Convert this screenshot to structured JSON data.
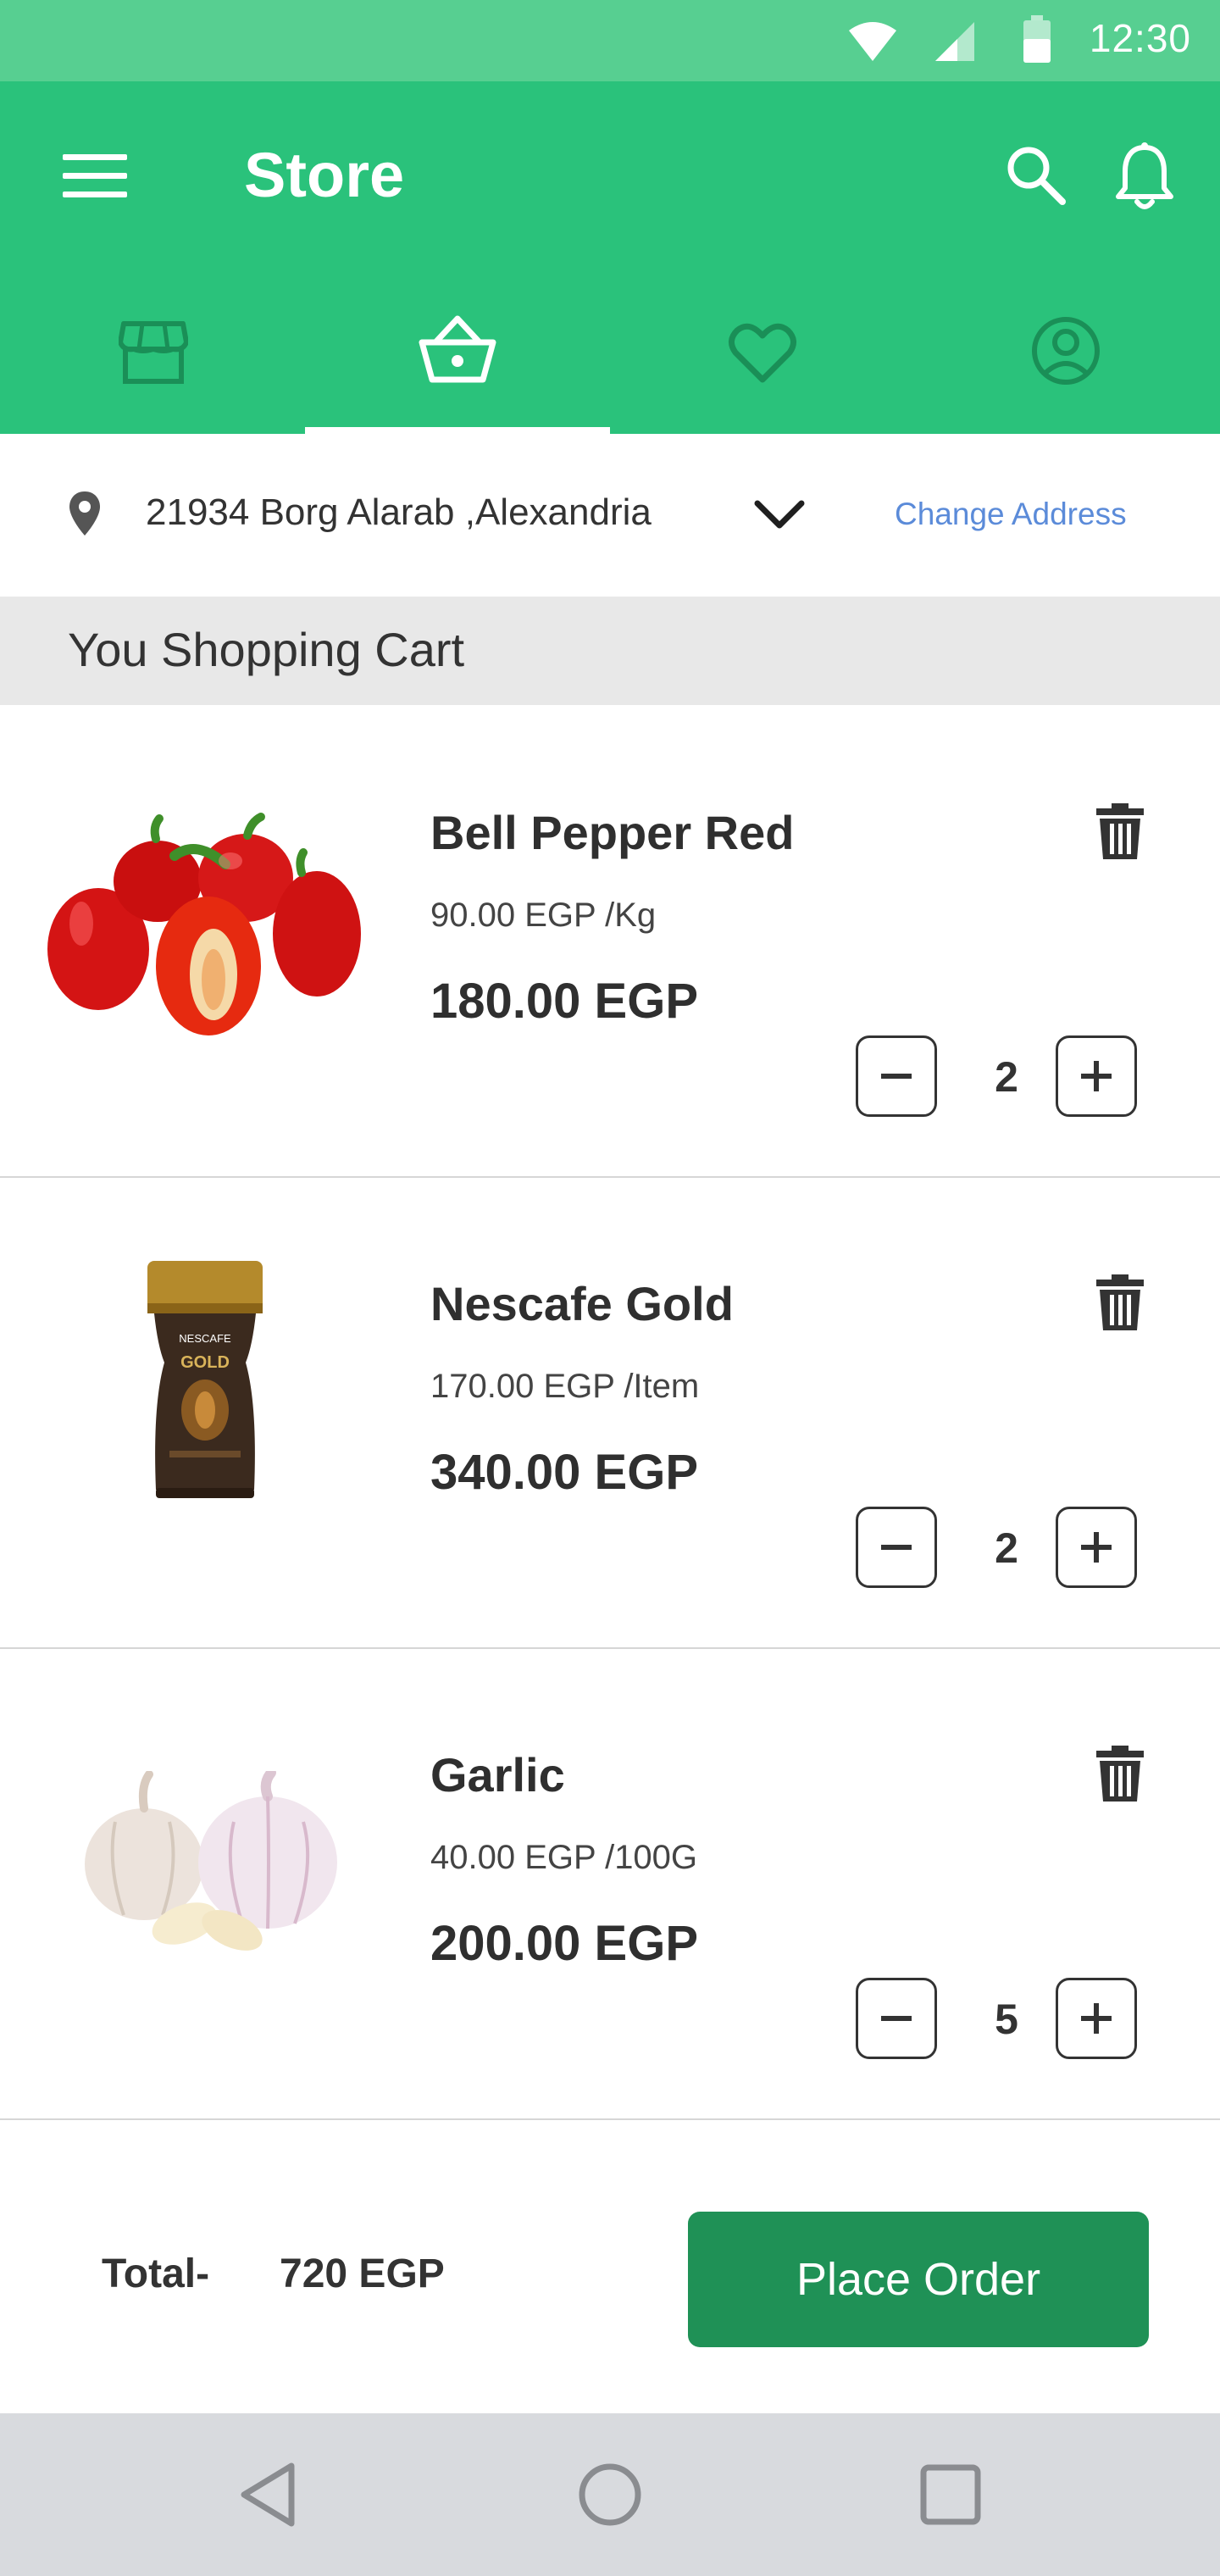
{
  "status_bar": {
    "time": "12:30"
  },
  "app_bar": {
    "title": "Store"
  },
  "tabs": [
    {
      "icon": "store-icon",
      "active": false
    },
    {
      "icon": "basket-icon",
      "active": true
    },
    {
      "icon": "heart-icon",
      "active": false
    },
    {
      "icon": "account-icon",
      "active": false
    }
  ],
  "address": {
    "text": "21934  Borg Alarab ,Alexandria",
    "change_label": "Change Address"
  },
  "cart": {
    "title": "You Shopping Cart",
    "items": [
      {
        "name": "Bell Pepper Red",
        "unit_price": "90.00 EGP /Kg",
        "total": "180.00 EGP",
        "quantity": "2"
      },
      {
        "name": "Nescafe Gold",
        "unit_price": "170.00 EGP /Item",
        "total": "340.00 EGP",
        "quantity": "2"
      },
      {
        "name": "Garlic",
        "unit_price": "40.00 EGP /100G",
        "total": "200.00 EGP",
        "quantity": "5"
      }
    ],
    "product_image_text": {
      "nescafe_brand": "NESCAFE",
      "nescafe_line": "GOLD"
    }
  },
  "footer": {
    "total_label": "Total-",
    "total_value": "720 EGP",
    "place_order_label": "Place Order"
  },
  "colors": {
    "primary": "#2ac27b",
    "status_bar": "#57cf91",
    "button": "#1f9156",
    "link": "#5b8bd9"
  }
}
